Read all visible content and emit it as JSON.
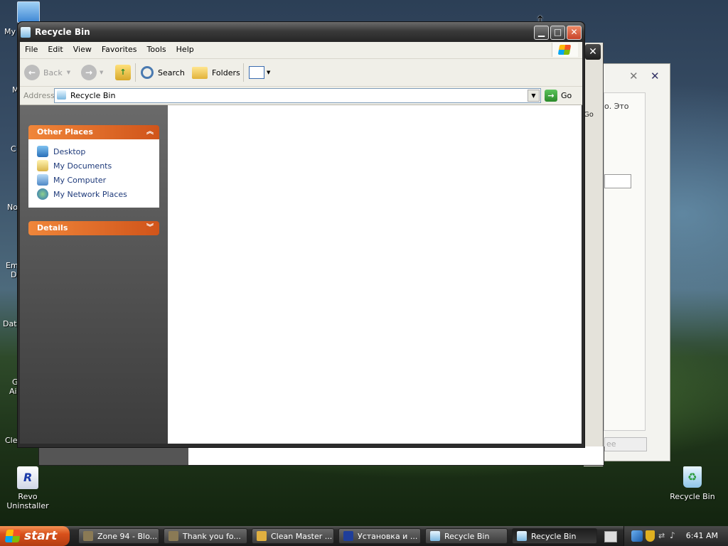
{
  "desktop": {
    "icons": [
      {
        "label": "Revo Uninstaller",
        "icon": "revo-uninstaller-icon"
      },
      {
        "label": "Recycle Bin",
        "icon": "recycle-bin-icon"
      }
    ],
    "cut_labels": [
      "My",
      "M",
      "C",
      "No",
      "Em",
      "D",
      "Data",
      "G",
      "Ai",
      "Cle"
    ]
  },
  "background_window": {
    "text": "о. Это",
    "go_fragment": "Go",
    "button_fragment": "ee"
  },
  "window": {
    "title": "Recycle Bin",
    "menu": [
      "File",
      "Edit",
      "View",
      "Favorites",
      "Tools",
      "Help"
    ],
    "toolbar": {
      "back": "Back",
      "search": "Search",
      "folders": "Folders"
    },
    "address": {
      "label": "Address",
      "value": "Recycle Bin",
      "go": "Go"
    },
    "other_places": {
      "title": "Other Places",
      "items": [
        "Desktop",
        "My Documents",
        "My Computer",
        "My Network Places"
      ]
    },
    "details": {
      "title": "Details"
    }
  },
  "taskbar": {
    "start_label": "start",
    "tasks": [
      {
        "label": "Zone 94 - Blo...",
        "active": false
      },
      {
        "label": "Thank you fo...",
        "active": false
      },
      {
        "label": "Clean Master ...",
        "active": false
      },
      {
        "label": "Установка и ...",
        "active": false
      },
      {
        "label": "Recycle Bin",
        "active": false
      },
      {
        "label": "Recycle Bin",
        "active": true
      }
    ],
    "clock": "6:41 AM"
  },
  "colors": {
    "accent_orange": "#e06a2c",
    "link_blue": "#1e3a7a"
  }
}
